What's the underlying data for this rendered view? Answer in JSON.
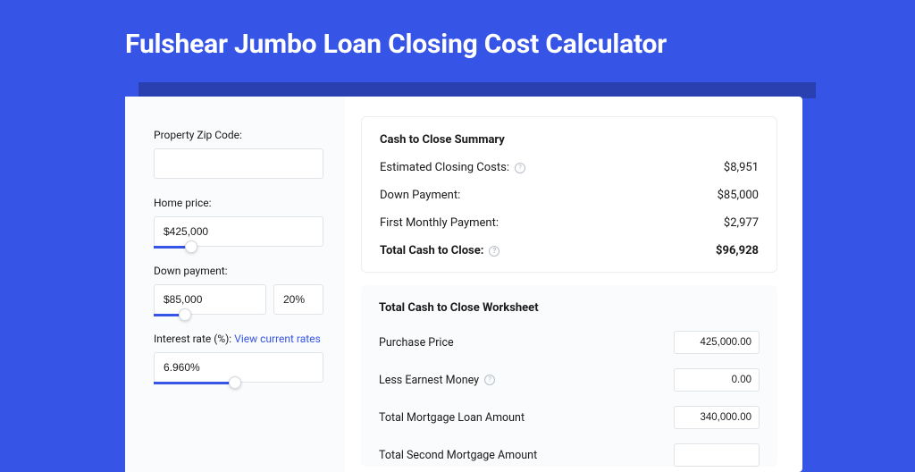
{
  "page_title": "Fulshear Jumbo Loan Closing Cost Calculator",
  "left": {
    "zip_label": "Property Zip Code:",
    "zip_value": "",
    "home_price_label": "Home price:",
    "home_price_value": "$425,000",
    "down_payment_label": "Down payment:",
    "down_payment_value": "$85,000",
    "down_payment_pct": "20%",
    "rate_label_prefix": "Interest rate (%): ",
    "rate_link": "View current rates",
    "rate_value": "6.960%"
  },
  "summary": {
    "title": "Cash to Close Summary",
    "rows": [
      {
        "label": "Estimated Closing Costs:",
        "value": "$8,951",
        "help": true,
        "bold": false
      },
      {
        "label": "Down Payment:",
        "value": "$85,000",
        "help": false,
        "bold": false
      },
      {
        "label": "First Monthly Payment:",
        "value": "$2,977",
        "help": false,
        "bold": false
      },
      {
        "label": "Total Cash to Close:",
        "value": "$96,928",
        "help": true,
        "bold": true
      }
    ]
  },
  "worksheet": {
    "title": "Total Cash to Close Worksheet",
    "rows": [
      {
        "label": "Purchase Price",
        "value": "425,000.00",
        "help": false
      },
      {
        "label": "Less Earnest Money",
        "value": "0.00",
        "help": true
      },
      {
        "label": "Total Mortgage Loan Amount",
        "value": "340,000.00",
        "help": false
      },
      {
        "label": "Total Second Mortgage Amount",
        "value": "",
        "help": false
      }
    ]
  }
}
